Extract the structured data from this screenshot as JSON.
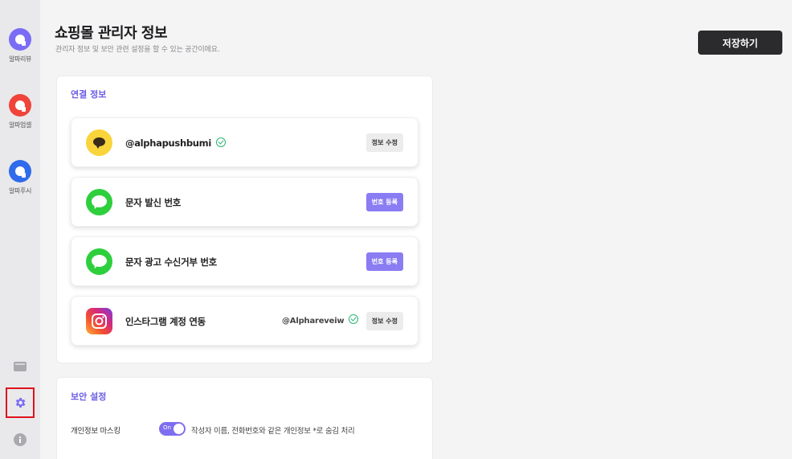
{
  "sidebar": {
    "apps": [
      {
        "label": "알파리뷰",
        "color": "#7a6cf5",
        "icon": "alpha-review-logo-icon"
      },
      {
        "label": "알파업셀",
        "color": "#f0443a",
        "icon": "alpha-upsell-logo-icon"
      },
      {
        "label": "알파푸시",
        "color": "#2f6bea",
        "icon": "alpha-push-logo-icon"
      }
    ],
    "bottom_icons": [
      "folder-icon",
      "gear-icon",
      "info-icon"
    ]
  },
  "header": {
    "title": "쇼핑몰 관리자 정보",
    "subtitle": "관리자 정보 및 보안 관련 설정을 할 수 있는 공간이에요.",
    "save_label": "저장하기"
  },
  "connection": {
    "title": "연결 정보",
    "cards": [
      {
        "label": "@alphapushbumi",
        "verified": true,
        "button": "정보 수정",
        "icon": "kakaotalk-icon"
      },
      {
        "label": "문자 발신 번호",
        "button": "번호 등록",
        "icon": "message-icon"
      },
      {
        "label": "문자 광고 수신거부 번호",
        "button": "번호 등록",
        "icon": "message-icon"
      },
      {
        "label": "인스타그램 계정 연동",
        "account": "@Alphareveiw",
        "verified": true,
        "button": "정보 수정",
        "icon": "instagram-icon"
      }
    ]
  },
  "security": {
    "title": "보안 설정",
    "masking_label": "개인정보 마스킹",
    "toggle_text": "On",
    "toggle_on": true,
    "masking_desc": "작성자 이름, 전화번호와 같은 개인정보 *로 숨김 처리"
  },
  "colors": {
    "accent": "#6b5ce7",
    "button_purple": "#8a7cf2",
    "dark_button": "#2b2b2e",
    "verified_green": "#2bb673",
    "highlight_red": "#e0131b"
  }
}
